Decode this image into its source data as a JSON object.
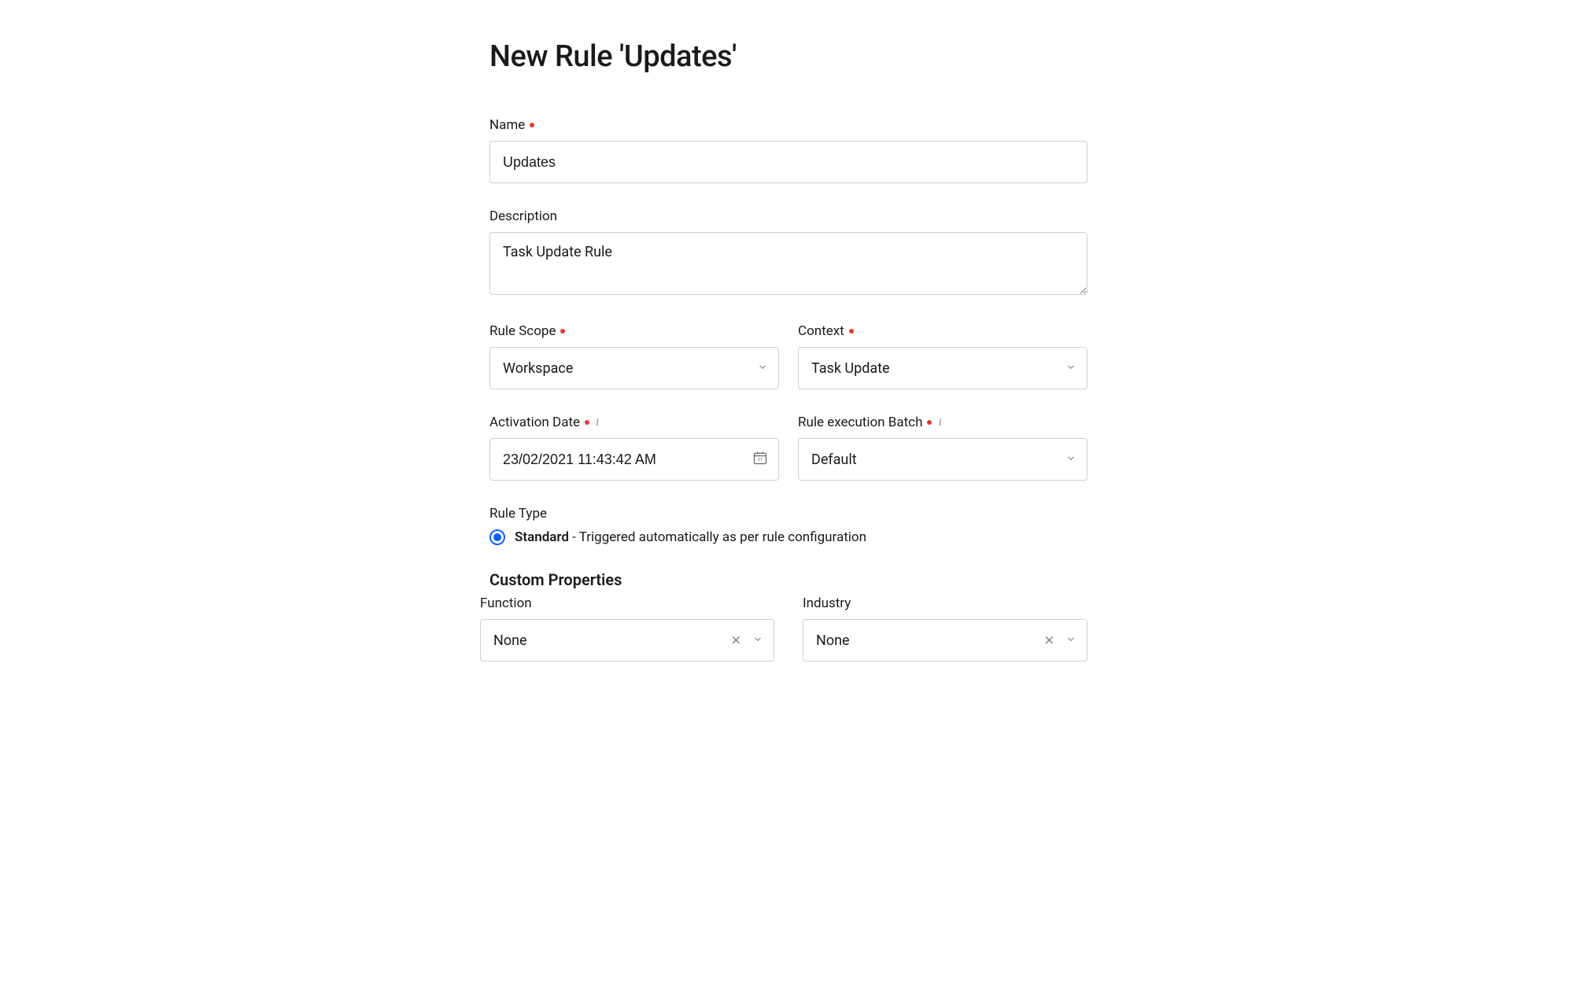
{
  "header": {
    "title": "New Rule 'Updates'"
  },
  "fields": {
    "name": {
      "label": "Name",
      "value": "Updates"
    },
    "description": {
      "label": "Description",
      "value": "Task Update Rule"
    },
    "ruleScope": {
      "label": "Rule Scope",
      "value": "Workspace"
    },
    "context": {
      "label": "Context",
      "value": "Task Update"
    },
    "activationDate": {
      "label": "Activation Date",
      "value": "23/02/2021 11:43:42 AM"
    },
    "ruleExecutionBatch": {
      "label": "Rule execution Batch",
      "value": "Default"
    },
    "ruleType": {
      "label": "Rule Type",
      "optionName": "Standard",
      "optionDescription": " - Triggered automatically as per rule configuration"
    }
  },
  "customProperties": {
    "title": "Custom Properties",
    "function": {
      "label": "Function",
      "value": "None"
    },
    "industry": {
      "label": "Industry",
      "value": "None"
    }
  }
}
